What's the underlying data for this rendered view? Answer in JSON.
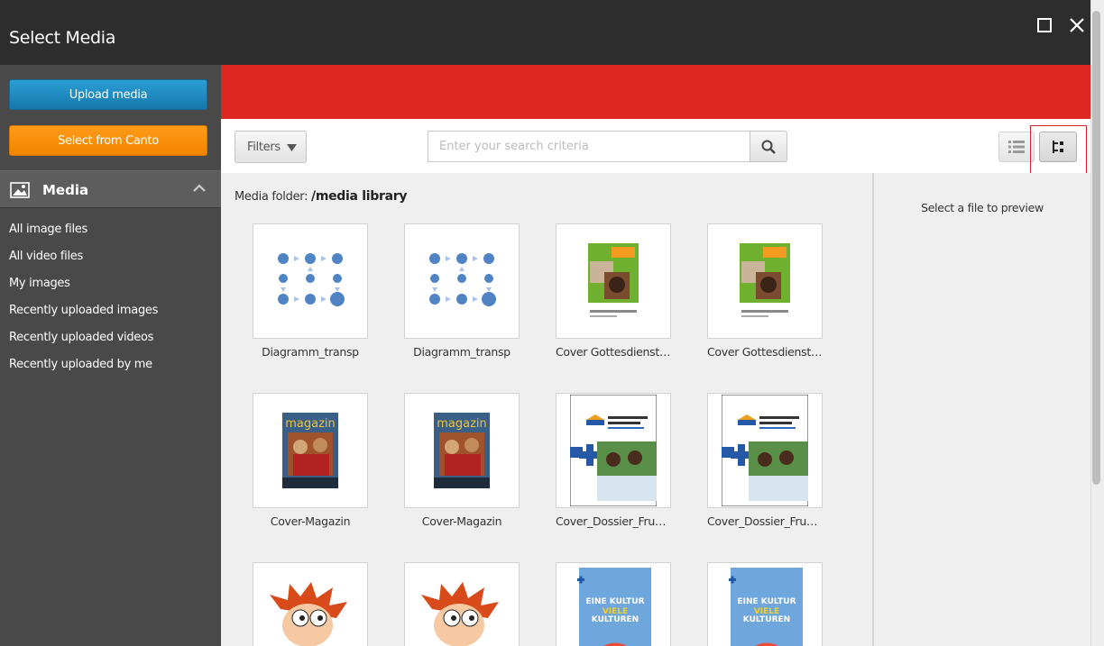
{
  "window": {
    "title": "Select Media"
  },
  "sidebar": {
    "upload_label": "Upload media",
    "canto_label": "Select from Canto",
    "section_label": "Media",
    "items": [
      {
        "label": "All image files"
      },
      {
        "label": "All video files"
      },
      {
        "label": "My images"
      },
      {
        "label": "Recently uploaded images"
      },
      {
        "label": "Recently uploaded videos"
      },
      {
        "label": "Recently uploaded by me"
      }
    ]
  },
  "toolbar": {
    "filters_label": "Filters",
    "search_placeholder": "Enter your search criteria"
  },
  "folder": {
    "prefix": "Media folder:",
    "path": "/media library"
  },
  "tiles": [
    {
      "name": "Diagramm_transp",
      "kind": "diagram"
    },
    {
      "name": "Diagramm_transp",
      "kind": "diagram"
    },
    {
      "name": "Cover Gottesdienstb...",
      "kind": "cover-green"
    },
    {
      "name": "Cover Gottesdienstb...",
      "kind": "cover-green"
    },
    {
      "name": "Cover-Magazin",
      "kind": "magazine"
    },
    {
      "name": "Cover-Magazin",
      "kind": "magazine"
    },
    {
      "name": "Cover_Dossier_Frue...",
      "kind": "dossier"
    },
    {
      "name": "Cover_Dossier_Frue...",
      "kind": "dossier"
    },
    {
      "name": "",
      "kind": "cartoon"
    },
    {
      "name": "",
      "kind": "cartoon"
    },
    {
      "name": "",
      "kind": "kultur"
    },
    {
      "name": "",
      "kind": "kultur"
    }
  ],
  "preview": {
    "empty_text": "Select a file to preview"
  },
  "colors": {
    "accent_red": "#dc2820",
    "upload_blue": "#1e8bc3",
    "canto_orange": "#f88e0a",
    "sidebar": "#494949"
  }
}
